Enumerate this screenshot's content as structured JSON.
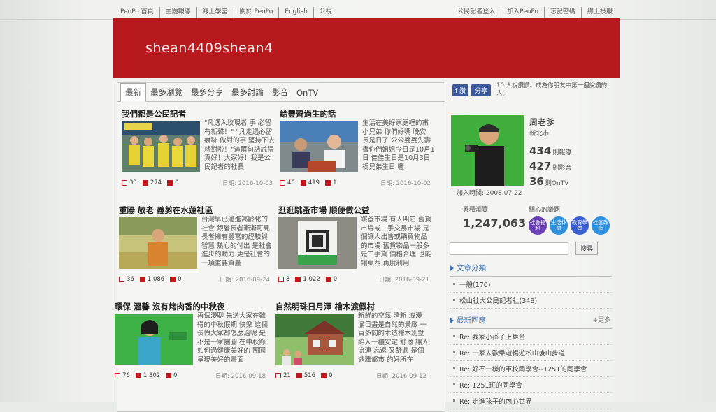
{
  "topnav": {
    "left": [
      "PeoPo 首頁",
      "主題報導",
      "線上學堂",
      "關於 PeoPo",
      "English",
      "公視"
    ],
    "right": [
      "公民記者登入",
      "加入PeoPo",
      "忘記密碼",
      "線上投服"
    ]
  },
  "banner": {
    "username": "shean4409shean4",
    "color": "#b7191c"
  },
  "tabs": [
    "最新",
    "最多瀏覽",
    "最多分享",
    "最多討論",
    "影音",
    "OnTV"
  ],
  "cards": [
    {
      "title": "我們都是公民記者",
      "excerpt": "\"凡透入玫現者 手 必留有新聲！\" \"凡走過必留痕跡 做對的事 堅持下去 就對啦！\"這兩句話說得真好！大家好！我是公民記者的社長",
      "likes": "33",
      "views": "274",
      "comments": "0",
      "date": "日期: 2016-10-03"
    },
    {
      "title": "給豐齊過生的話",
      "excerpt": "生活在美好家庭裡的甫小兄弟 你們好嗎 晚安 長是日了 公公婆婆先壽書你們姐姐今日是10月1日 佳佳生日是10月3日 祝兄弟生日 喔",
      "likes": "40",
      "views": "419",
      "comments": "1",
      "date": "日期: 2016-10-02"
    },
    {
      "title": "重陽 敬老 義剪在水蓮社區",
      "excerpt": "台灣早已邁進高齡化的社會 銀髮長者漸漸可見 長者擁有豐富的經驗與智慧 熱心的付出 是社會進步的動力 更是社會的一項重要資產",
      "likes": "36",
      "views": "1,086",
      "comments": "0",
      "date": "日期: 2016-09-24"
    },
    {
      "title": "逛逛跳蚤市場 順便做公益",
      "excerpt": "跳蚤市場 有人叫它 舊貨市場或二手交易市場 是個讓人出售或購買物品的市場 舊貨物品一般多是二手貨 價格合理 也能讓東西 再度利用",
      "likes": "8",
      "views": "1,022",
      "comments": "0",
      "date": "日期: 2016-09-21"
    },
    {
      "title": "環保 溫馨 沒有烤肉香的中秋夜",
      "excerpt": "再個漫聊 先送大家在難得的中秋假期 快樂 這個長假大家都怎麼過呢 是不是一家團圓 在中秋節 如何過健康美好的 團圓 呈現美好的畫面",
      "likes": "76",
      "views": "1,302",
      "comments": "0",
      "date": "日期: 2016-09-18"
    },
    {
      "title": "自然明珠日月潭 檜木渡假村",
      "excerpt": "新鮮的空氣 清新 浪漫 滿目盡是自然的景緻 一百多間的木造檜木別墅 給人一種安定 舒適 讓人流連 忘返 又舒適 是個 逃離都市 的好所在",
      "likes": "21",
      "views": "516",
      "comments": "0",
      "date": "日期: 2016-09-12"
    }
  ],
  "share": {
    "fb": "f 讚",
    "share": "分享",
    "text": "10 人說讚讚。成為你朋友中第一個說讚的人。"
  },
  "profile": {
    "name": "周老爹",
    "location": "新北市",
    "stat1": "434",
    "stat1_label": "則報導",
    "stat2": "427",
    "stat2_label": "則影音",
    "stat3": "36",
    "stat3_label": "則OnTV",
    "join": "加入時間: 2008.07.22"
  },
  "views": {
    "label": "累積瀏覽",
    "count": "1,247,063"
  },
  "topics": {
    "label": "關心的議題",
    "items": [
      {
        "text": "社會福利",
        "color": "#6a3fb5"
      },
      {
        "text": "生活休閒",
        "color": "#2d8fd8"
      },
      {
        "text": "教育學習",
        "color": "#3a5fcf"
      },
      {
        "text": "社區改造",
        "color": "#2f8fe0"
      }
    ]
  },
  "search": {
    "button": "搜尋"
  },
  "categories": {
    "title": "文章分類",
    "items": [
      "一般(170)",
      "松山社大公民記者社(348)"
    ]
  },
  "replies": {
    "title": "最新回應",
    "more": "+更多",
    "items": [
      "Re: 我家小孫子上舞台",
      "Re: 一家人歡樂遊暢遊松山後山步道",
      "Re: 好不一樣的軍校同學會--1251的同學會",
      "Re: 1251班的同學會",
      "Re: 走進孩子的內心世界"
    ]
  }
}
